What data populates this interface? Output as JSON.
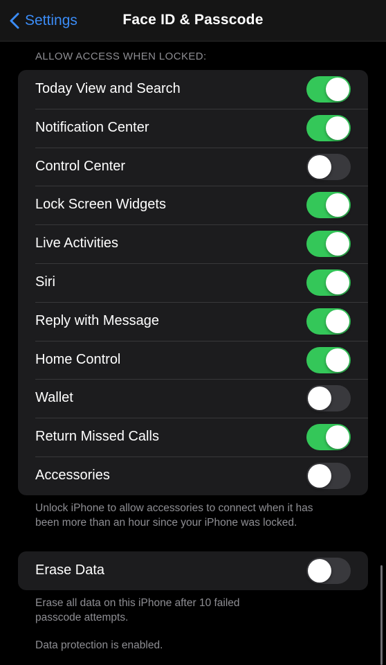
{
  "nav": {
    "back_label": "Settings",
    "title": "Face ID & Passcode"
  },
  "allow_access": {
    "header": "ALLOW ACCESS WHEN LOCKED:",
    "items": [
      {
        "label": "Today View and Search",
        "on": true
      },
      {
        "label": "Notification Center",
        "on": true
      },
      {
        "label": "Control Center",
        "on": false
      },
      {
        "label": "Lock Screen Widgets",
        "on": true
      },
      {
        "label": "Live Activities",
        "on": true
      },
      {
        "label": "Siri",
        "on": true
      },
      {
        "label": "Reply with Message",
        "on": true
      },
      {
        "label": "Home Control",
        "on": true
      },
      {
        "label": "Wallet",
        "on": false
      },
      {
        "label": "Return Missed Calls",
        "on": true
      },
      {
        "label": "Accessories",
        "on": false
      }
    ],
    "footer_line1": "Unlock iPhone to allow accessories to connect when it has",
    "footer_line2": "been more than an hour since your iPhone was locked."
  },
  "erase": {
    "label": "Erase Data",
    "on": false,
    "footer_line1": "Erase all data on this iPhone after 10 failed",
    "footer_line2": "passcode attempts.",
    "footer_line3": "Data protection is enabled."
  },
  "colors": {
    "accent": "#3b8cf6",
    "toggle_on": "#34c759",
    "toggle_off": "#39393d",
    "cell_background": "#1c1c1e",
    "secondary_text": "#8e8e93"
  }
}
